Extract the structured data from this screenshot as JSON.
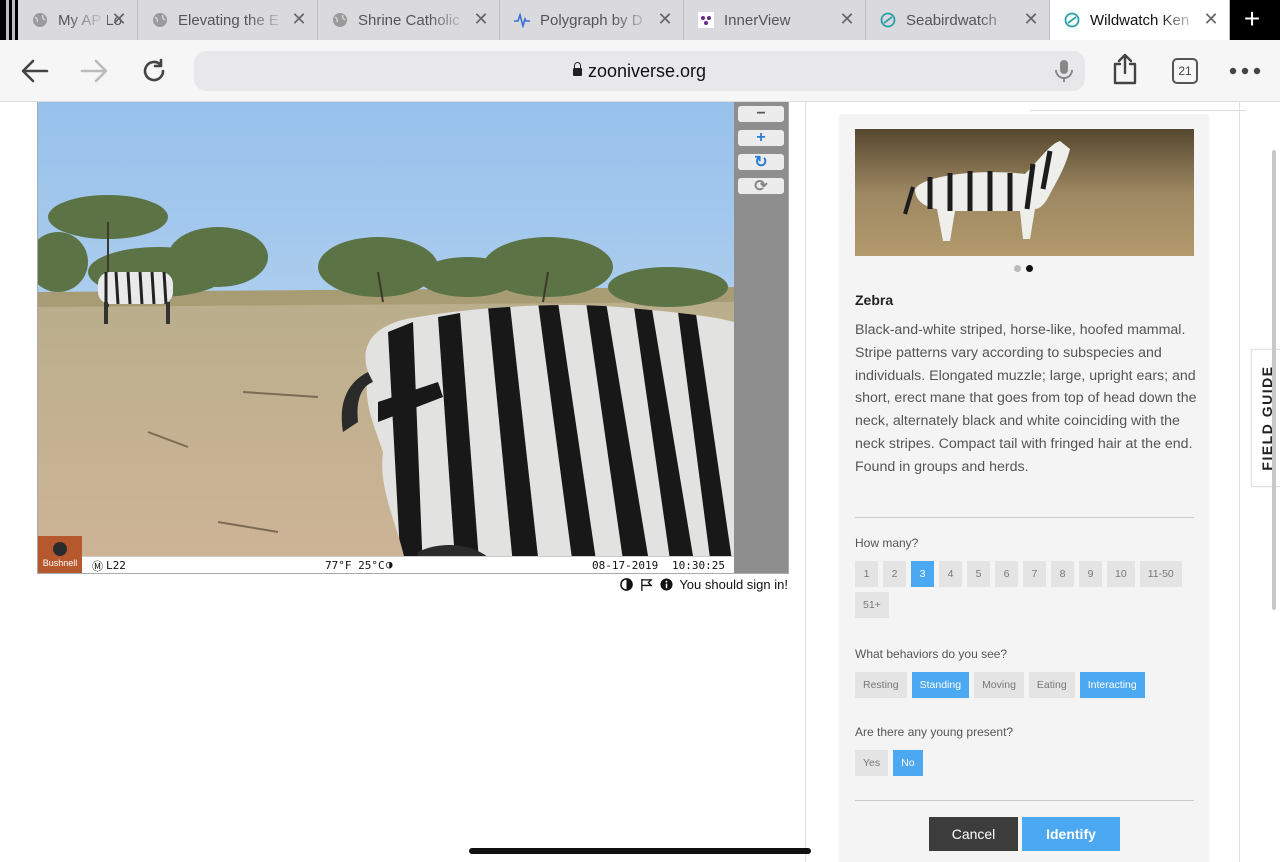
{
  "browser": {
    "tabs": [
      {
        "title": "My AP Lo",
        "icon": "globe-icon",
        "active": false
      },
      {
        "title": "Elevating the E",
        "icon": "globe-icon",
        "active": false
      },
      {
        "title": "Shrine Catholic",
        "icon": "globe-icon",
        "active": false
      },
      {
        "title": "Polygraph by D",
        "icon": "pulse-icon",
        "active": false
      },
      {
        "title": "InnerView",
        "icon": "innerview-icon",
        "active": false
      },
      {
        "title": "Seabirdwatch",
        "icon": "zooniverse-icon",
        "active": false
      },
      {
        "title": "Wildwatch Ken",
        "icon": "zooniverse-icon",
        "active": true
      }
    ],
    "url": "zooniverse.org",
    "tab_count": "21"
  },
  "camera": {
    "brand": "Bushnell",
    "camera_id": "L22",
    "temperature": "77°F 25°C",
    "date": "08-17-2019",
    "time": "10:30:25"
  },
  "subject_tools": {
    "sign_in_text": "You should sign in!"
  },
  "species": {
    "name": "Zebra",
    "description": "Black-and-white striped, horse-like, hoofed mammal. Stripe patterns vary according to subspecies and individuals. Elongated muzzle; large, upright ears; and short, erect mane that goes from top of head down the neck, alternately black and white coinciding with the neck stripes. Compact tail with fringed hair at the end. Found in groups and herds.",
    "image_count": 2,
    "image_index": 1
  },
  "questions": {
    "how_many": {
      "label": "How many?",
      "options": [
        "1",
        "2",
        "3",
        "4",
        "5",
        "6",
        "7",
        "8",
        "9",
        "10",
        "11-50",
        "51+"
      ],
      "selected": [
        "3"
      ]
    },
    "behaviors": {
      "label": "What behaviors do you see?",
      "options": [
        "Resting",
        "Standing",
        "Moving",
        "Eating",
        "Interacting"
      ],
      "selected": [
        "Standing",
        "Interacting"
      ]
    },
    "young": {
      "label": "Are there any young present?",
      "options": [
        "Yes",
        "No"
      ],
      "selected": [
        "No"
      ]
    }
  },
  "actions": {
    "cancel_label": "Cancel",
    "identify_label": "Identify"
  },
  "field_guide_label": "FIELD GUIDE",
  "colors": {
    "selected": "#4ca8f0",
    "cancel": "#3c3c3c",
    "camera_logo": "#b5582e"
  }
}
